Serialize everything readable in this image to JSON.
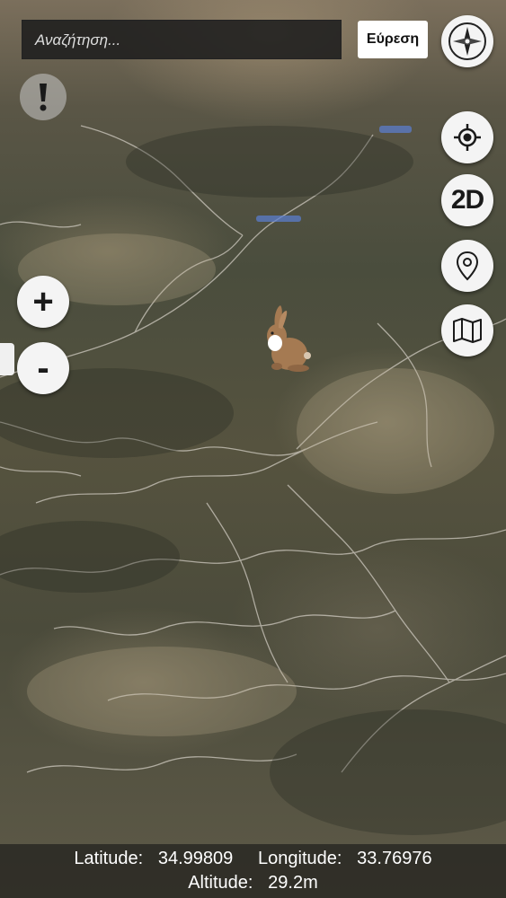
{
  "search": {
    "placeholder": "Αναζήτηση...",
    "button_label": "Εύρεση"
  },
  "controls": {
    "view_mode_label": "2D",
    "zoom_in_label": "+",
    "zoom_out_label": "-"
  },
  "status": {
    "latitude_label": "Latitude:",
    "latitude_value": "34.99809",
    "longitude_label": "Longitude:",
    "longitude_value": "33.76976",
    "altitude_label": "Altitude:",
    "altitude_value": "29.2m"
  },
  "icons": [
    "compass-icon",
    "alert-icon",
    "locate-icon",
    "pin-icon",
    "map-icon",
    "hare-icon"
  ],
  "colors": {
    "button_bg": "#f4f4f4",
    "search_bg": "#1e1e1e",
    "road": "#d8d4cc"
  }
}
